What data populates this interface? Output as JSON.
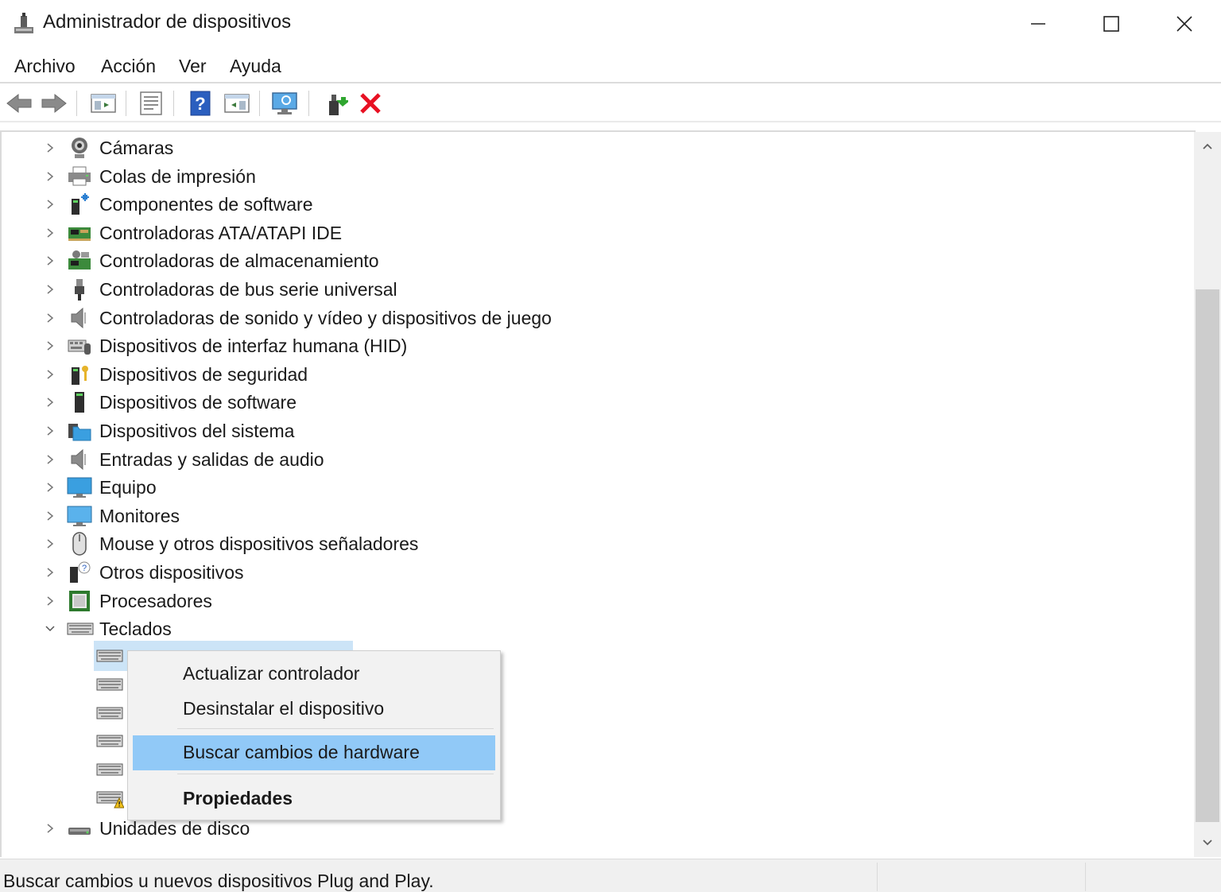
{
  "window": {
    "title": "Administrador de dispositivos"
  },
  "menu": [
    "Archivo",
    "Acción",
    "Ver",
    "Ayuda"
  ],
  "toolbar": {
    "icons": [
      "back-icon",
      "forward-icon",
      "show-hide-tree-icon",
      "properties-icon",
      "help-icon",
      "view-icon",
      "monitor-scan-icon",
      "update-driver-icon",
      "uninstall-icon"
    ]
  },
  "tree": {
    "categories": [
      {
        "label": "Cámaras",
        "icon": "camera-icon",
        "expanded": false
      },
      {
        "label": "Colas de impresión",
        "icon": "printer-icon",
        "expanded": false
      },
      {
        "label": "Componentes de software",
        "icon": "software-component-icon",
        "expanded": false
      },
      {
        "label": "Controladoras ATA/ATAPI IDE",
        "icon": "ide-controller-icon",
        "expanded": false
      },
      {
        "label": "Controladoras de almacenamiento",
        "icon": "storage-controller-icon",
        "expanded": false
      },
      {
        "label": "Controladoras de bus serie universal",
        "icon": "usb-icon",
        "expanded": false
      },
      {
        "label": "Controladoras de sonido y vídeo y dispositivos de juego",
        "icon": "speaker-icon",
        "expanded": false
      },
      {
        "label": "Dispositivos de interfaz humana (HID)",
        "icon": "hid-icon",
        "expanded": false
      },
      {
        "label": "Dispositivos de seguridad",
        "icon": "security-device-icon",
        "expanded": false
      },
      {
        "label": "Dispositivos de software",
        "icon": "software-device-icon",
        "expanded": false
      },
      {
        "label": "Dispositivos del sistema",
        "icon": "system-folder-icon",
        "expanded": false
      },
      {
        "label": "Entradas y salidas de audio",
        "icon": "audio-icon",
        "expanded": false
      },
      {
        "label": "Equipo",
        "icon": "computer-icon",
        "expanded": false
      },
      {
        "label": "Monitores",
        "icon": "monitor-icon",
        "expanded": false
      },
      {
        "label": "Mouse y otros dispositivos señaladores",
        "icon": "mouse-icon",
        "expanded": false
      },
      {
        "label": "Otros dispositivos",
        "icon": "unknown-device-icon",
        "expanded": false
      },
      {
        "label": "Procesadores",
        "icon": "processor-icon",
        "expanded": false
      },
      {
        "label": "Teclados",
        "icon": "keyboard-icon",
        "expanded": true
      }
    ],
    "keyboard_children_count": 6,
    "last_category": {
      "label": "Unidades de disco",
      "icon": "disk-drive-icon",
      "expanded": false
    }
  },
  "context_menu": {
    "items": [
      {
        "label": "Actualizar controlador",
        "active": false,
        "bold": false
      },
      {
        "label": "Desinstalar el dispositivo",
        "active": false,
        "bold": false
      },
      {
        "label": "Buscar cambios de hardware",
        "active": true,
        "bold": false
      },
      {
        "label": "Propiedades",
        "active": false,
        "bold": true
      }
    ]
  },
  "status": {
    "text": "Buscar cambios u nuevos dispositivos Plug and Play."
  },
  "colors": {
    "selection": "#91c9f7",
    "tree_selection": "#cce4f7",
    "uninstall": "#e81123"
  }
}
